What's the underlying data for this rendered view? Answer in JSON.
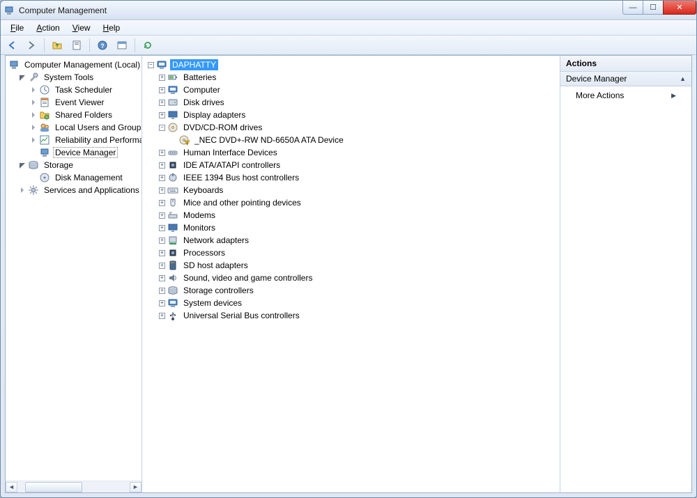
{
  "window": {
    "title": "Computer Management"
  },
  "menus": {
    "file": "File",
    "action": "Action",
    "view": "View",
    "help": "Help"
  },
  "left_tree": {
    "root": "Computer Management (Local)",
    "system_tools": "System Tools",
    "task_scheduler": "Task Scheduler",
    "event_viewer": "Event Viewer",
    "shared_folders": "Shared Folders",
    "local_users": "Local Users and Groups",
    "reliability": "Reliability and Performance",
    "device_manager": "Device Manager",
    "storage": "Storage",
    "disk_management": "Disk Management",
    "services_apps": "Services and Applications"
  },
  "mid_tree": {
    "root": "DAPHATTY",
    "batteries": "Batteries",
    "computer": "Computer",
    "disk_drives": "Disk drives",
    "display_adapters": "Display adapters",
    "dvd": "DVD/CD-ROM drives",
    "dvd_child": "_NEC DVD+-RW ND-6650A ATA Device",
    "hid": "Human Interface Devices",
    "ide": "IDE ATA/ATAPI controllers",
    "ieee1394": "IEEE 1394 Bus host controllers",
    "keyboards": "Keyboards",
    "mice": "Mice and other pointing devices",
    "modems": "Modems",
    "monitors": "Monitors",
    "network": "Network adapters",
    "processors": "Processors",
    "sdhost": "SD host adapters",
    "sound": "Sound, video and game controllers",
    "storagectl": "Storage controllers",
    "sysdev": "System devices",
    "usb": "Universal Serial Bus controllers"
  },
  "actions": {
    "header": "Actions",
    "group": "Device Manager",
    "more": "More Actions"
  }
}
